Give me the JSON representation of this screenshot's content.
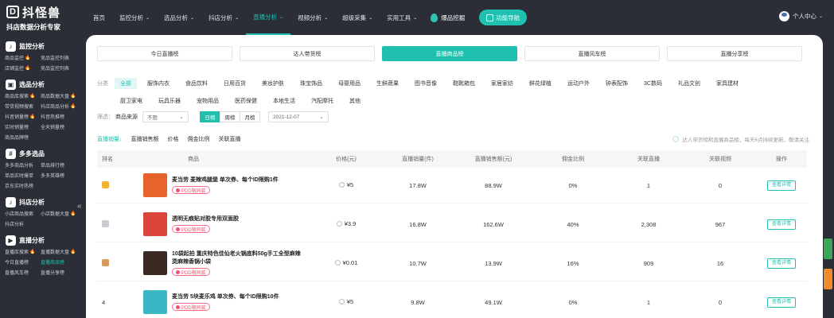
{
  "brand": {
    "name": "抖怪兽",
    "logo_letter": "D",
    "tagline": "抖店数据分析专家"
  },
  "nav": {
    "items": [
      {
        "label": "首页",
        "caret": false
      },
      {
        "label": "监控分析",
        "caret": true
      },
      {
        "label": "选品分析",
        "caret": true
      },
      {
        "label": "抖店分析",
        "caret": true
      },
      {
        "label": "直播分析",
        "caret": true,
        "active": true
      },
      {
        "label": "视频分析",
        "caret": true
      },
      {
        "label": "超级采集",
        "caret": true
      },
      {
        "label": "实用工具",
        "caret": true
      }
    ],
    "hot_label": "爆品挖掘",
    "feature_label": "功能导航",
    "caret_glyph": "⌄"
  },
  "user": {
    "label": "个人中心",
    "caret": "⌄"
  },
  "sidebar": {
    "sections": [
      {
        "title": "监控分析",
        "icon": "tiktok-icon",
        "items": [
          {
            "label": "商品监控",
            "hot": true
          },
          {
            "label": "竞品监控列表"
          },
          {
            "label": "店铺监控",
            "hot": true
          },
          {
            "label": "竞品监控列表"
          }
        ]
      },
      {
        "title": "选品分析",
        "icon": "bag-icon",
        "items": [
          {
            "label": "商品库搜索",
            "hot": true
          },
          {
            "label": "商品数据大盘",
            "hot": true
          },
          {
            "label": "带货视频搜索"
          },
          {
            "label": "抖店商品分析",
            "hot": true
          },
          {
            "label": "抖音销量榜",
            "hot": true
          },
          {
            "label": "抖音热推榜"
          },
          {
            "label": "实时销量榜"
          },
          {
            "label": "全天销量榜"
          },
          {
            "label": "商品品牌榜"
          }
        ]
      },
      {
        "title": "多多选品",
        "icon": "grid-icon",
        "items": [
          {
            "label": "多多商品分析"
          },
          {
            "label": "单品排行榜"
          },
          {
            "label": "单品实时爆单"
          },
          {
            "label": "多多英雄榜"
          },
          {
            "label": "京东实时热榜"
          }
        ]
      },
      {
        "title": "抖店分析",
        "icon": "tiktok-icon",
        "items": [
          {
            "label": "小店商品搜索"
          },
          {
            "label": "小店数据大盘",
            "hot": true
          },
          {
            "label": "抖店分析"
          }
        ]
      },
      {
        "title": "直播分析",
        "icon": "play-icon",
        "items": [
          {
            "label": "直播库搜索",
            "hot": true
          },
          {
            "label": "直播数据大盘",
            "hot": true
          },
          {
            "label": "今日直播榜"
          },
          {
            "label": "直播商品榜",
            "active": true
          },
          {
            "label": "直播风车榜"
          },
          {
            "label": "直播分享榜"
          }
        ]
      }
    ],
    "hot_glyph": "🔥",
    "collapse_glyph": "«"
  },
  "tabs": [
    {
      "label": "今日直播榜"
    },
    {
      "label": "达人带货榜"
    },
    {
      "label": "直播商品榜",
      "active": true
    },
    {
      "label": "直播风车榜"
    },
    {
      "label": "直播分享榜"
    }
  ],
  "categories": {
    "label": "分类",
    "row1": [
      "全部",
      "服饰内衣",
      "食品饮料",
      "日用百货",
      "美妆护肤",
      "珠宝饰品",
      "母婴用品",
      "生鲜蔬果",
      "图书音像",
      "鞋靴箱包",
      "家居家纺",
      "鲜花绿植",
      "运动户外",
      "钟表配饰",
      "3C数码",
      "礼品文创",
      "家具建材"
    ],
    "row2": [
      "厨卫家电",
      "玩具乐器",
      "宠物用品",
      "医药保健",
      "本地生活",
      "汽配摩托",
      "其他"
    ],
    "active": "全部"
  },
  "filter": {
    "label": "筛选：",
    "source_label": "商品来源",
    "source_value": "不限",
    "periods": [
      "日榜",
      "周榜",
      "月榜"
    ],
    "active_period": "日榜",
    "date": "2021-12-07",
    "caret": "⌄"
  },
  "sort": {
    "items": [
      "直播销量↓",
      "直播销售额",
      "价格",
      "佣金比例",
      "关联直播"
    ],
    "active": "直播销量↓",
    "hint": "达人带货榜和直播商品榜，每天6点持续更新，敬请关注"
  },
  "table": {
    "headers": {
      "rank": "排名",
      "product": "商品",
      "price": "价格(元)",
      "volume": "直播销量(件)",
      "amount": "直播销售额(元)",
      "commission": "佣金比例",
      "live": "关联直播",
      "video": "关联视频",
      "op": "操作"
    },
    "detail_label": "查看详情",
    "rows": [
      {
        "rank": "",
        "medal": "#f2b233",
        "title": "麦当劳 麦辣鸡腿堡 单次券、每个ID限购1件",
        "badge": "PDD限同款",
        "price": "¥5",
        "volume": "17.8W",
        "amount": "88.9W",
        "commission": "0%",
        "live": "1",
        "video": "0",
        "thumb": "#e7632b"
      },
      {
        "rank": "",
        "medal": "#c9ccd2",
        "title": "透明无痕贴对胶专用双面胶",
        "badge": "PDD限同款",
        "price": "¥3.9",
        "volume": "16.8W",
        "amount": "162.6W",
        "commission": "40%",
        "live": "2,308",
        "video": "967",
        "thumb": "#d9453a"
      },
      {
        "rank": "",
        "medal": "#d79a5a",
        "title": "10袋起拍 重庆特色佳仙老火锅底料50g手工全型麻辣烫麻辣香锅小袋",
        "badge": "PDD限同款",
        "price": "¥0.01",
        "volume": "10.7W",
        "amount": "13.9W",
        "commission": "16%",
        "live": "909",
        "video": "16",
        "thumb": "#3a2a22"
      },
      {
        "rank": "4",
        "medal": "",
        "title": "麦当劳 5块麦乐鸡 单次券、每个ID限购10件",
        "badge": "PDD限同款",
        "price": "¥5",
        "volume": "9.8W",
        "amount": "49.1W",
        "commission": "0%",
        "live": "1",
        "video": "0",
        "thumb": "#3bb6c4"
      }
    ]
  },
  "right_tabs": [
    "#3aa657",
    "#f08a2b"
  ]
}
